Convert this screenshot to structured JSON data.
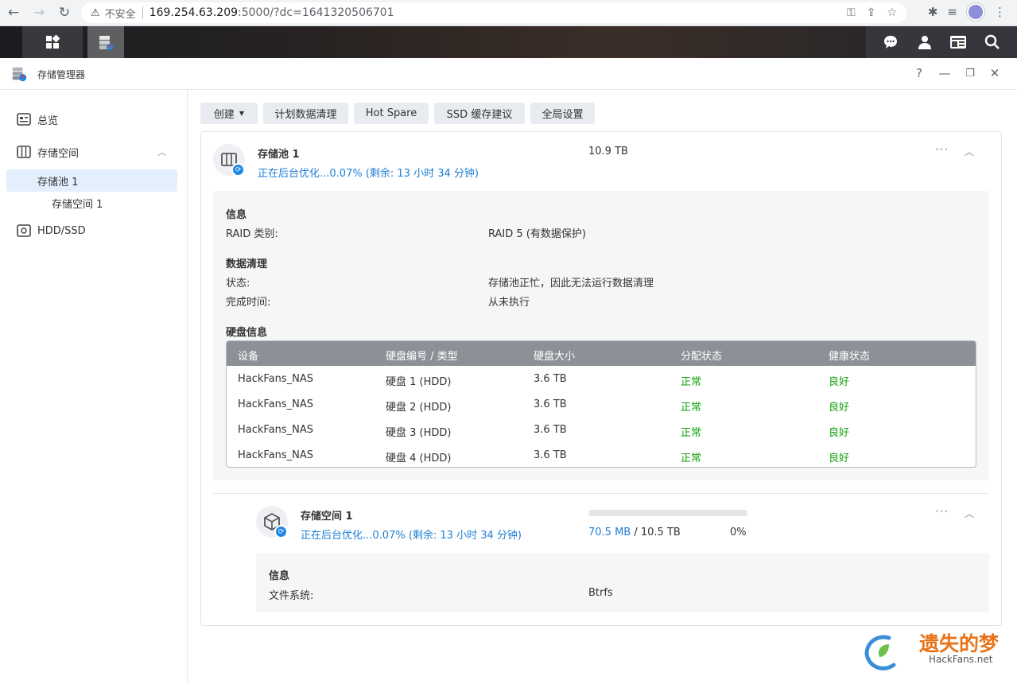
{
  "browser": {
    "insecure_label": "不安全",
    "url_host": "169.254.63.209",
    "url_rest": ":5000/?dc=1641320506701"
  },
  "window": {
    "title": "存储管理器",
    "help": "?",
    "minimize": "—",
    "restore": "❐",
    "close": "✕"
  },
  "sidebar": {
    "items": [
      {
        "label": "总览"
      },
      {
        "label": "存储空间"
      },
      {
        "label": "存储池 1"
      },
      {
        "label": "存储空间 1"
      },
      {
        "label": "HDD/SSD"
      }
    ]
  },
  "toolbar": {
    "create": "创建",
    "scrub": "计划数据清理",
    "hotspare": "Hot Spare",
    "ssd": "SSD 缓存建议",
    "global": "全局设置"
  },
  "pool": {
    "title": "存储池 1",
    "status": "正在后台优化...0.07% (剩余: 13 小时 34 分钟)",
    "size": "10.9 TB",
    "info_title": "信息",
    "raid_label": "RAID 类别:",
    "raid_value": "RAID 5 (有数据保护)",
    "scrub_title": "数据清理",
    "state_label": "状态:",
    "state_value": "存储池正忙，因此无法运行数据清理",
    "done_label": "完成时间:",
    "done_value": "从未执行",
    "disk_title": "硬盘信息",
    "columns": [
      "设备",
      "硬盘编号 / 类型",
      "硬盘大小",
      "分配状态",
      "健康状态"
    ],
    "disks": [
      {
        "device": "HackFans_NAS",
        "disk": "硬盘 1 (HDD)",
        "size": "3.6 TB",
        "alloc": "正常",
        "health": "良好"
      },
      {
        "device": "HackFans_NAS",
        "disk": "硬盘 2 (HDD)",
        "size": "3.6 TB",
        "alloc": "正常",
        "health": "良好"
      },
      {
        "device": "HackFans_NAS",
        "disk": "硬盘 3 (HDD)",
        "size": "3.6 TB",
        "alloc": "正常",
        "health": "良好"
      },
      {
        "device": "HackFans_NAS",
        "disk": "硬盘 4 (HDD)",
        "size": "3.6 TB",
        "alloc": "正常",
        "health": "良好"
      }
    ]
  },
  "volume": {
    "title": "存储空间 1",
    "status": "正在后台优化...0.07% (剩余: 13 小时 34 分钟)",
    "used": "70.5 MB",
    "total_sep": " / 10.5 TB",
    "percent": "0%",
    "usage_fraction": 0.0,
    "info_title": "信息",
    "fs_label": "文件系统:",
    "fs_value": "Btrfs"
  },
  "watermark": {
    "text": "遗失的梦",
    "site": "HackFans.net"
  },
  "colors": {
    "accent": "#1e7ed4",
    "ok": "#13a10e",
    "table_head": "#8c9198"
  }
}
